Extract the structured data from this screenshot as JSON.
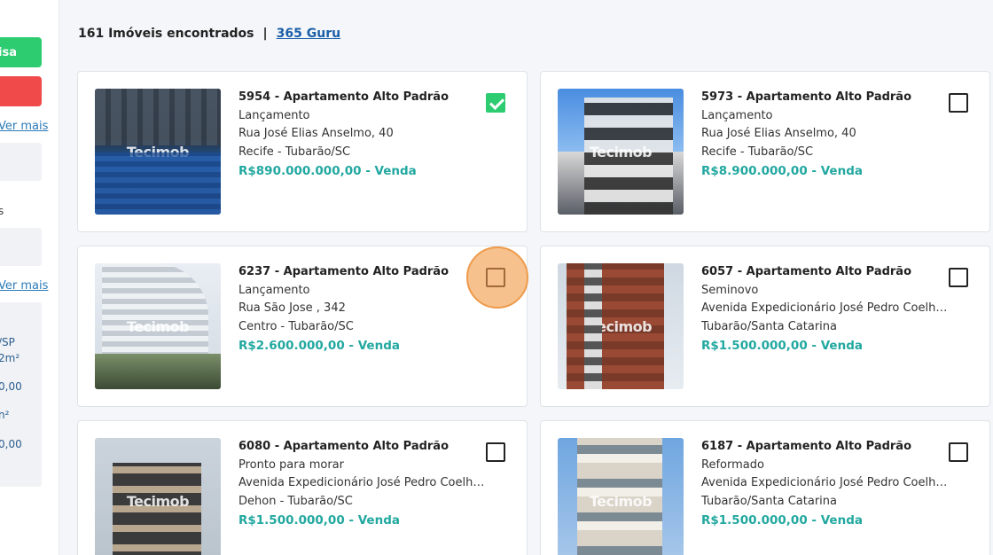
{
  "sidebar": {
    "btn_search": "isa",
    "btn_clear": "",
    "link_more_1": "Ver mais",
    "label_s": "s",
    "link_more_2": "Ver mais",
    "frag_sp": "/SP",
    "frag_area1": "2m²",
    "frag_val1": "0,00",
    "frag_area2": "n²",
    "frag_val2": "0,00"
  },
  "header": {
    "count_text": "161 Imóveis encontrados",
    "separator": "|",
    "guru_link": "365 Guru"
  },
  "watermark": "Tecimob",
  "listings": [
    {
      "title": "5954 - Apartamento Alto Padrão",
      "status": "Lançamento",
      "address": "Rua José Elias Anselmo, 40",
      "location": "Recife - Tubarão/SC",
      "price": "R$890.000.000,00 - Venda",
      "selected": true,
      "image": "pool-building"
    },
    {
      "title": "5973 - Apartamento Alto Padrão",
      "status": "Lançamento",
      "address": "Rua José Elias Anselmo, 40",
      "location": "Recife - Tubarão/SC",
      "price": "R$8.900.000,00 - Venda",
      "selected": false,
      "image": "modern-building"
    },
    {
      "title": "6237 - Apartamento Alto Padrão",
      "status": "Lançamento",
      "address": "Rua São Jose , 342",
      "location": "Centro - Tubarão/SC",
      "price": "R$2.600.000,00 - Venda",
      "selected": false,
      "image": "white-tower"
    },
    {
      "title": "6057 - Apartamento Alto Padrão",
      "status": "Seminovo",
      "address": "Avenida Expedicionário José Pedro Coelho, ...",
      "location": "Tubarão/Santa Catarina",
      "price": "R$1.500.000,00 - Venda",
      "selected": false,
      "image": "brick-tower"
    },
    {
      "title": "6080 - Apartamento Alto Padrão",
      "status": "Pronto para morar",
      "address": "Avenida Expedicionário José Pedro Coelho, ...",
      "location": "Dehon - Tubarão/SC",
      "price": "R$1.500.000,00 - Venda",
      "selected": false,
      "image": "dark-modern-building"
    },
    {
      "title": "6187 - Apartamento Alto Padrão",
      "status": "Reformado",
      "address": "Avenida Expedicionário José Pedro Coelho, ...",
      "location": "Tubarão/Santa Catarina",
      "price": "R$1.500.000,00 - Venda",
      "selected": false,
      "image": "balcony-building"
    }
  ],
  "colors": {
    "price": "#22a8a0",
    "checked": "#2ecc71",
    "highlight": "#f6c18c",
    "link": "#1a5fa8"
  }
}
